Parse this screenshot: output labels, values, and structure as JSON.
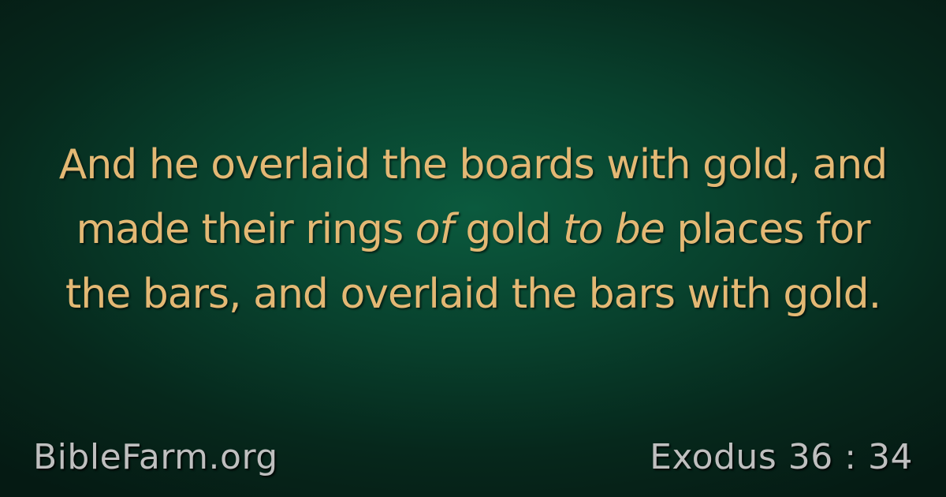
{
  "verse": {
    "line1": "And he overlaid the boards with gold, and",
    "line2_a": "made their rings ",
    "line2_i1": "of",
    "line2_b": " gold ",
    "line2_i2": "to be",
    "line2_c": " places for",
    "line3": "the bars, and overlaid the bars with gold."
  },
  "footer": {
    "site": "BibleFarm.org",
    "reference": "Exodus 36 : 34"
  },
  "colors": {
    "background": "#08412d",
    "verse_text": "#e3b874",
    "footer_text": "#bfbfbf"
  }
}
